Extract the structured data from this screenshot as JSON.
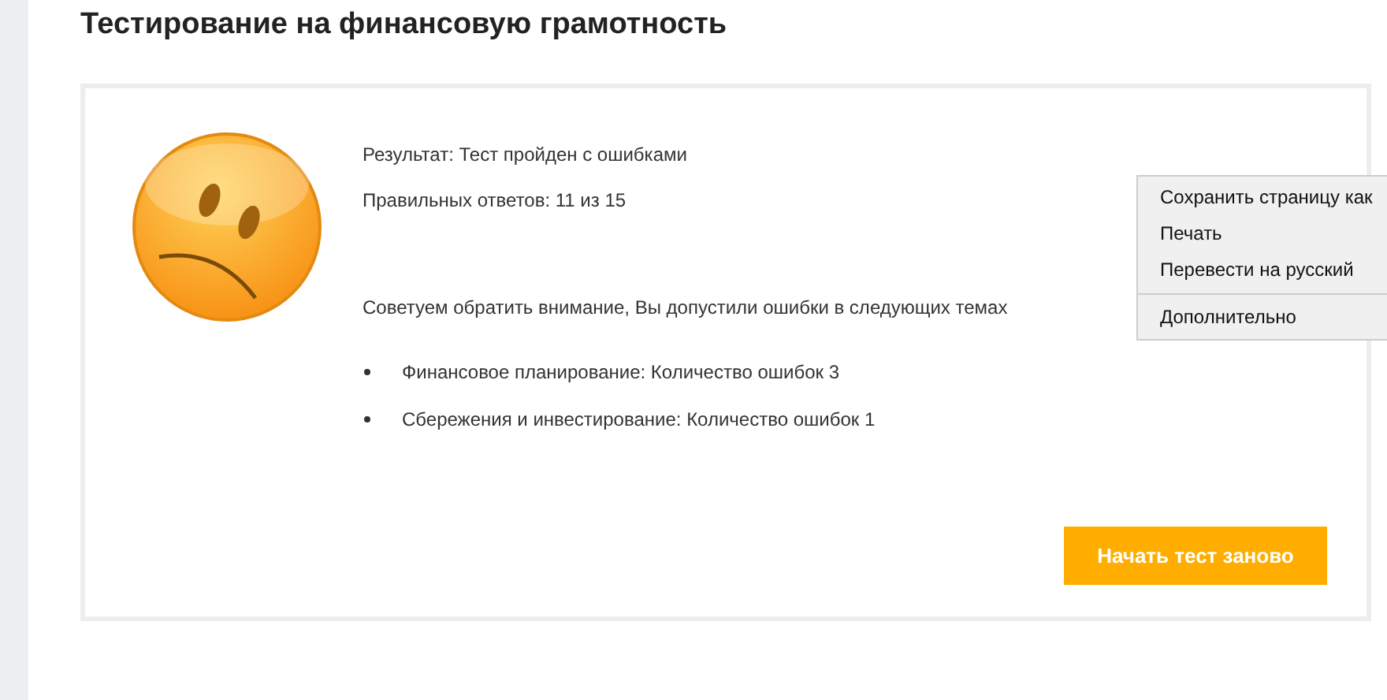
{
  "page": {
    "title": "Тестирование на финансовую грамотность"
  },
  "result": {
    "status": "Результат: Тест пройден с ошибками",
    "score": "Правильных ответов: 11 из 15",
    "advice": "Советуем обратить внимание, Вы допустили ошибки в следующих темах",
    "topics": [
      "Финансовое планирование: Количество ошибок 3",
      "Сбережения и инвестирование: Количество ошибок 1"
    ],
    "restart_button": "Начать тест заново"
  },
  "context_menu": {
    "items": [
      {
        "label": "Сохранить страницу как",
        "separator_before": false
      },
      {
        "label": "Печать",
        "separator_before": false
      },
      {
        "label": "Перевести на русский",
        "separator_before": false
      },
      {
        "label": "Дополнительно",
        "separator_before": true
      }
    ]
  }
}
